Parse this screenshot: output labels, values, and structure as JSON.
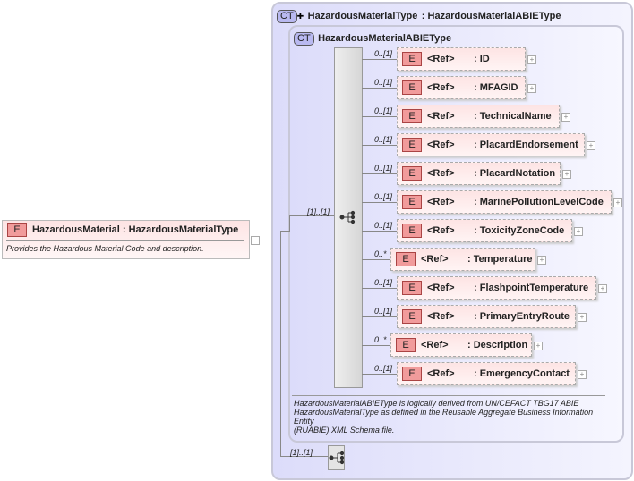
{
  "root": {
    "badge": "E",
    "name": "HazardousMaterial",
    "type": ": HazardousMaterialType",
    "doc": "Provides the Hazardous Material Code and description.",
    "collapse": "−"
  },
  "outer": {
    "badge": "CT",
    "name": "HazardousMaterialType",
    "base": ": HazardousMaterialABIEType"
  },
  "inner": {
    "badge": "CT",
    "name": "HazardousMaterialABIEType",
    "doc": [
      "HazardousMaterialABIEType is logically derived from UN/CEFACT TBG17 ABIE",
      "HazardousMaterialType as defined in the Reusable Aggregate Business Information",
      "Entity",
      "(RUABIE) XML Schema file."
    ]
  },
  "seq_card": "[1]..[1]",
  "seq2_card": "[1]..[1]",
  "elements": [
    {
      "card": "0..[1]",
      "badge": "E",
      "ref": "<Ref>",
      "name": ": ID"
    },
    {
      "card": "0..[1]",
      "badge": "E",
      "ref": "<Ref>",
      "name": ": MFAGID"
    },
    {
      "card": "0..[1]",
      "badge": "E",
      "ref": "<Ref>",
      "name": ": TechnicalName"
    },
    {
      "card": "0..[1]",
      "badge": "E",
      "ref": "<Ref>",
      "name": ": PlacardEndorsement"
    },
    {
      "card": "0..[1]",
      "badge": "E",
      "ref": "<Ref>",
      "name": ": PlacardNotation"
    },
    {
      "card": "0..[1]",
      "badge": "E",
      "ref": "<Ref>",
      "name": ": MarinePollutionLevelCode"
    },
    {
      "card": "0..[1]",
      "badge": "E",
      "ref": "<Ref>",
      "name": ": ToxicityZoneCode"
    },
    {
      "card": "0..*",
      "badge": "E",
      "ref": "<Ref>",
      "name": ": Temperature"
    },
    {
      "card": "0..[1]",
      "badge": "E",
      "ref": "<Ref>",
      "name": ": FlashpointTemperature"
    },
    {
      "card": "0..[1]",
      "badge": "E",
      "ref": "<Ref>",
      "name": ": PrimaryEntryRoute"
    },
    {
      "card": "0..*",
      "badge": "E",
      "ref": "<Ref>",
      "name": ": Description"
    },
    {
      "card": "0..[1]",
      "badge": "E",
      "ref": "<Ref>",
      "name": ": EmergencyContact"
    }
  ]
}
